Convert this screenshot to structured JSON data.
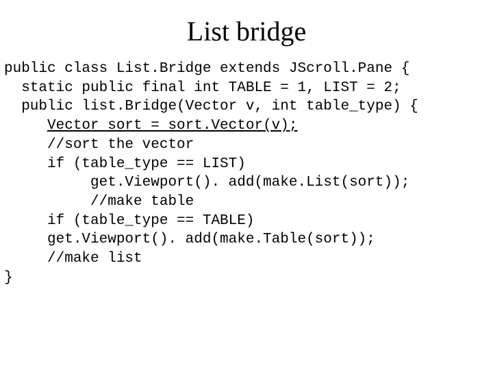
{
  "title": "List bridge",
  "code": {
    "l1": "public class List.Bridge extends JScroll.Pane {",
    "l2": "  static public final int TABLE = 1, LIST = 2;",
    "l3": "  public list.Bridge(Vector v, int table_type) {",
    "l4_indent": "     ",
    "l4_underlined": "Vector sort = sort.Vector(v);",
    "l5": "     //sort the vector",
    "l6": "     if (table_type == LIST)",
    "l7": "          get.Viewport(). add(make.List(sort));",
    "l8": "          //make table",
    "l9": "     if (table_type == TABLE)",
    "l10": "     get.Viewport(). add(make.Table(sort));",
    "l11": "     //make list",
    "l12": "}"
  }
}
